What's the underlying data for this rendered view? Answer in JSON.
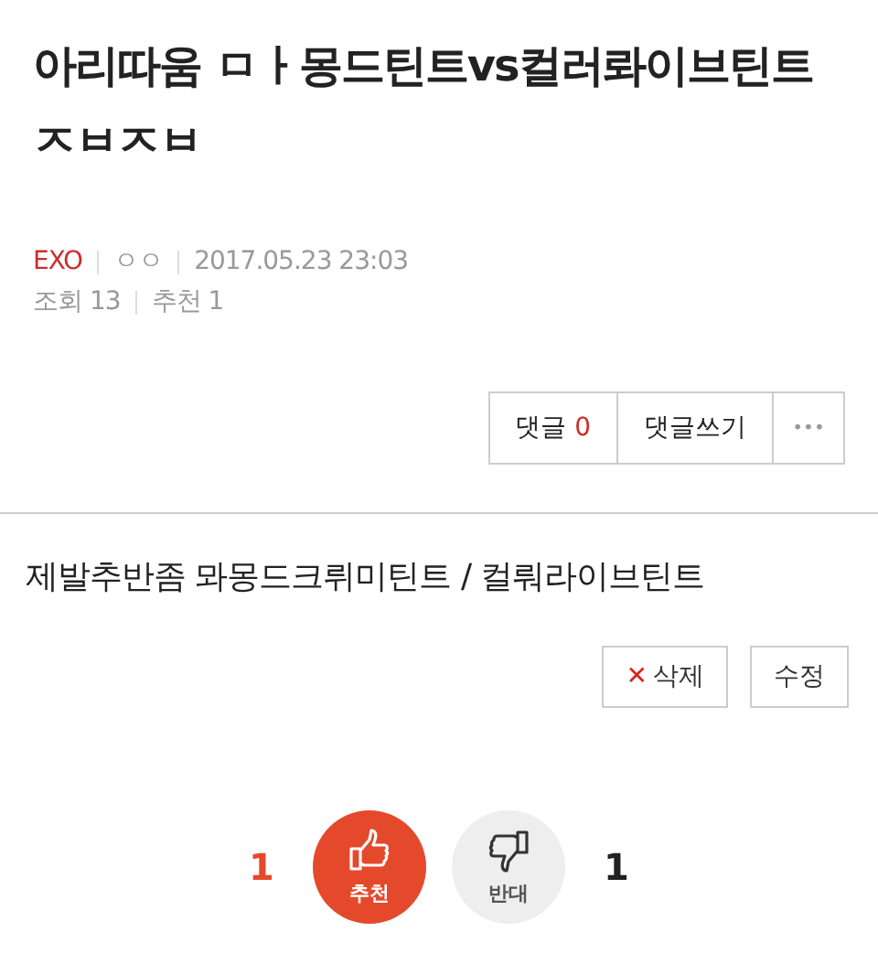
{
  "post": {
    "title": "아리따움 ㅁㅏ몽드틴트vs컬러롸이브틴트 ㅈㅂㅈㅂ",
    "board": "EXO",
    "author": "ㅇㅇ",
    "date": "2017.05.23 23:03",
    "views_label": "조회 13",
    "recommend_label": "추천 1"
  },
  "comment_bar": {
    "comments_label": "댓글",
    "comments_count": "0",
    "write_label": "댓글쓰기",
    "more_label": "•••"
  },
  "body": "제발추반좀 뫄몽드크뤼미틴트 / 컬뤄라이브틴트",
  "actions": [
    {
      "kind": "delete",
      "icon": "✕",
      "label": "삭제"
    },
    {
      "kind": "edit",
      "label": "수정"
    }
  ],
  "votes": [
    {
      "kind": "up",
      "count": "1",
      "label": "추천",
      "selected": true
    },
    {
      "kind": "down",
      "count": "1",
      "label": "반대",
      "selected": false
    }
  ]
}
